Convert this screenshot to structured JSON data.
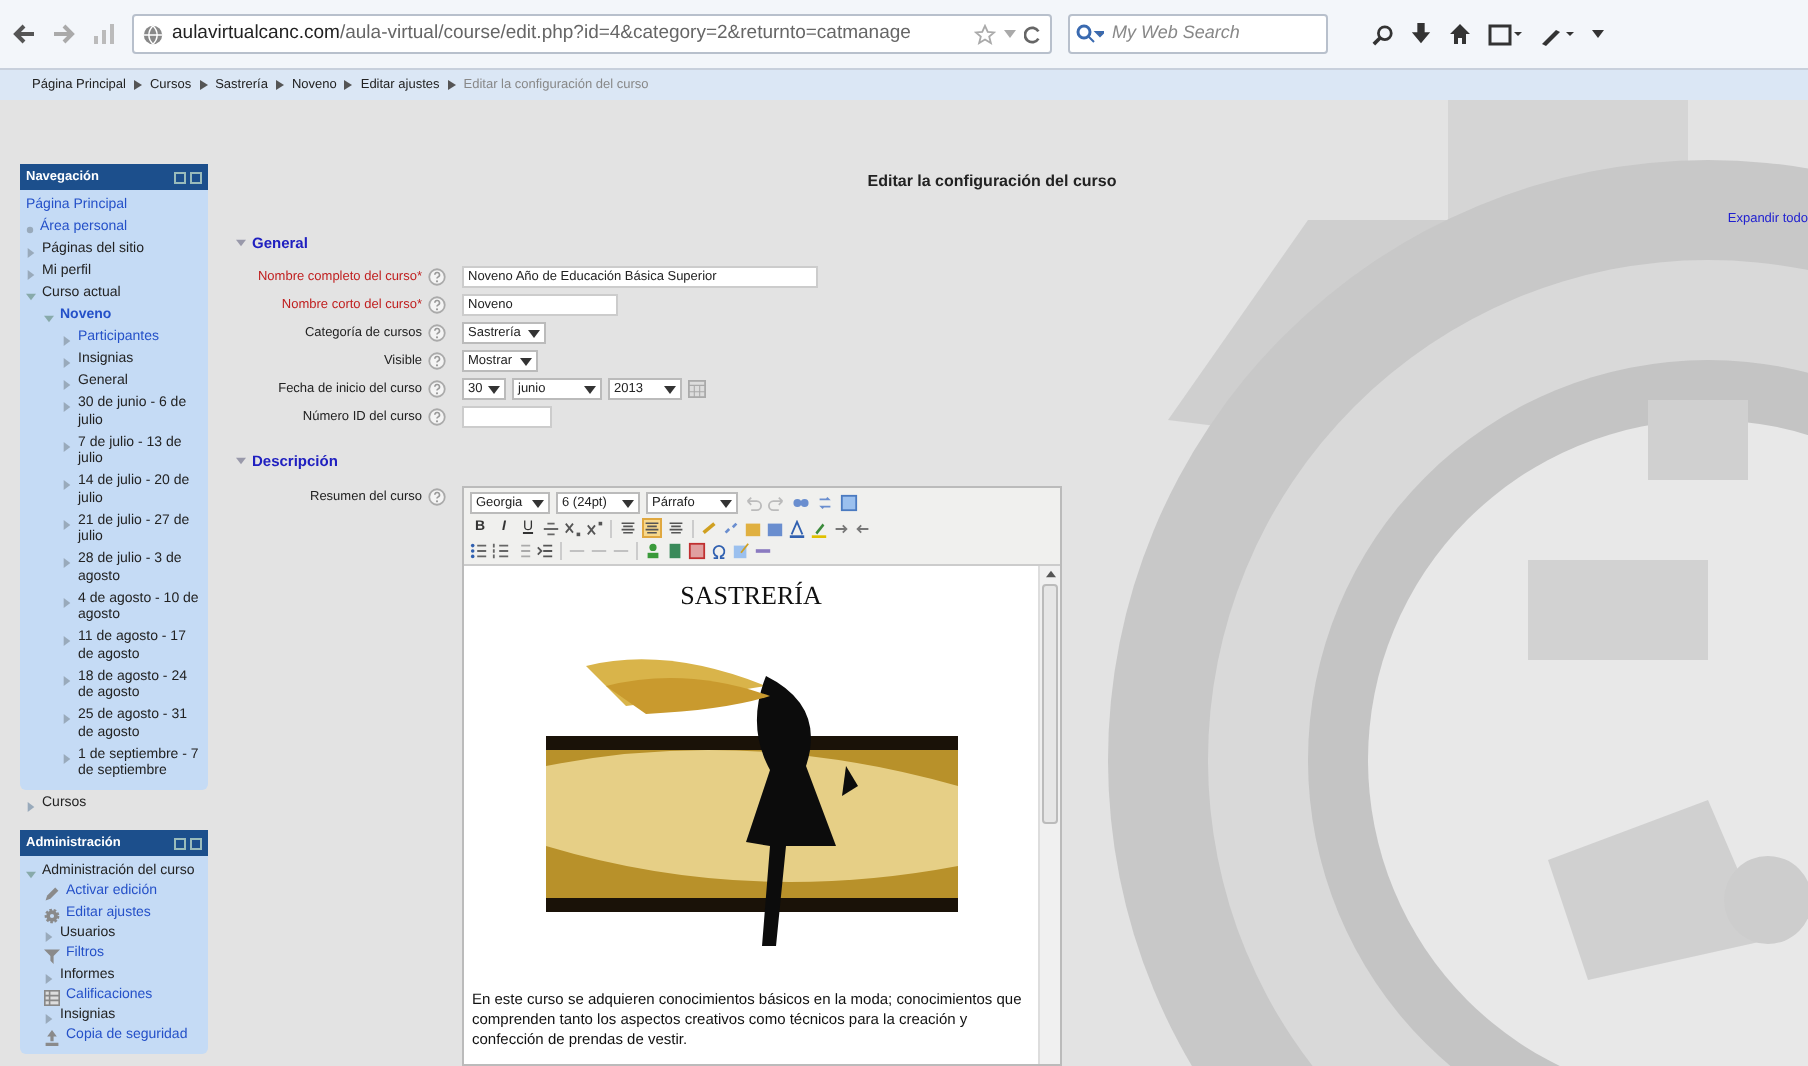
{
  "browser": {
    "url": "**aulavirtualcanc.com**/aula-virtual/course/edit.php?id=4&category=2&returnto=catmanage",
    "search": {
      "placeholder": "My Web Search"
    }
  },
  "breadcrumb": [
    {
      "label": "Página Principal",
      "current": false
    },
    {
      "label": "Cursos",
      "current": false
    },
    {
      "label": "Sastrería",
      "current": false
    },
    {
      "label": "Noveno",
      "current": false
    },
    {
      "label": "Editar ajustes",
      "current": false
    },
    {
      "label": "Editar la configuración del curso",
      "current": true
    }
  ],
  "navigation": {
    "title": "Navegación",
    "items": [
      {
        "label": "Página Principal",
        "kind": "plain",
        "link": true
      },
      {
        "label": "Área personal",
        "kind": "bullet",
        "link": true
      },
      {
        "label": "Páginas del sitio",
        "kind": "branch",
        "expanded": false,
        "link": false
      },
      {
        "label": "Mi perfil",
        "kind": "branch",
        "expanded": false,
        "link": false
      },
      {
        "label": "Curso actual",
        "kind": "branch",
        "expanded": true,
        "link": false,
        "children": [
          {
            "label": "Noveno",
            "kind": "branch",
            "expanded": true,
            "link": true,
            "current": true,
            "children": [
              {
                "label": "Participantes",
                "kind": "branch",
                "expanded": false,
                "link": true
              },
              {
                "label": "Insignias",
                "kind": "branch",
                "expanded": false,
                "link": false
              },
              {
                "label": "General",
                "kind": "branch",
                "expanded": false,
                "link": false
              },
              {
                "label": "30 de junio - 6 de julio",
                "kind": "branch",
                "expanded": false,
                "link": false
              },
              {
                "label": "7 de julio - 13 de julio",
                "kind": "branch",
                "expanded": false,
                "link": false
              },
              {
                "label": "14 de julio - 20 de julio",
                "kind": "branch",
                "expanded": false,
                "link": false
              },
              {
                "label": "21 de julio - 27 de julio",
                "kind": "branch",
                "expanded": false,
                "link": false
              },
              {
                "label": "28 de julio - 3 de agosto",
                "kind": "branch",
                "expanded": false,
                "link": false
              },
              {
                "label": "4 de agosto - 10 de agosto",
                "kind": "branch",
                "expanded": false,
                "link": false
              },
              {
                "label": "11 de agosto - 17 de agosto",
                "kind": "branch",
                "expanded": false,
                "link": false
              },
              {
                "label": "18 de agosto - 24 de agosto",
                "kind": "branch",
                "expanded": false,
                "link": false
              },
              {
                "label": "25 de agosto - 31 de agosto",
                "kind": "branch",
                "expanded": false,
                "link": false
              },
              {
                "label": "1 de septiembre - 7 de septiembre",
                "kind": "branch",
                "expanded": false,
                "link": false
              }
            ]
          }
        ]
      }
    ],
    "outside": [
      {
        "label": "Cursos",
        "kind": "branch",
        "expanded": false,
        "link": false
      }
    ]
  },
  "administration": {
    "title": "Administración",
    "items": [
      {
        "label": "Administración del curso",
        "kind": "branch",
        "expanded": true,
        "link": false,
        "children": [
          {
            "label": "Activar edición",
            "kind": "icon",
            "link": true
          },
          {
            "label": "Editar ajustes",
            "kind": "icon",
            "link": true
          },
          {
            "label": "Usuarios",
            "kind": "branch",
            "expanded": false,
            "link": false
          },
          {
            "label": "Filtros",
            "kind": "icon",
            "link": true
          },
          {
            "label": "Informes",
            "kind": "branch",
            "expanded": false,
            "link": false
          },
          {
            "label": "Calificaciones",
            "kind": "icon",
            "link": true
          },
          {
            "label": "Insignias",
            "kind": "branch",
            "expanded": false,
            "link": false
          },
          {
            "label": "Copia de seguridad",
            "kind": "icon",
            "link": true
          }
        ]
      }
    ]
  },
  "page_title": "Editar la configuración del curso",
  "expand_all": "Expandir todo",
  "sections": [
    {
      "legend": "General",
      "expanded": true,
      "fields": [
        {
          "label": "Nombre completo del curso*",
          "required": true,
          "kind": "text",
          "value": "Noveno Año de Educación Básica Superior"
        },
        {
          "label": "Nombre corto del curso*",
          "required": true,
          "kind": "text",
          "value": "Noveno"
        },
        {
          "label": "Categoría de cursos",
          "required": false,
          "kind": "select",
          "value": "Sastrería"
        },
        {
          "label": "Visible",
          "required": false,
          "kind": "select",
          "value": "Mostrar"
        },
        {
          "label": "Fecha de inicio del curso",
          "required": false,
          "kind": "date",
          "day": "30",
          "month": "junio",
          "year": "2013"
        },
        {
          "label": "Número ID del curso",
          "required": false,
          "kind": "text"
        }
      ]
    },
    {
      "legend": "Descripción",
      "expanded": true,
      "fields": [
        {
          "label": "Resumen del curso",
          "required": false,
          "kind": "editor"
        }
      ]
    }
  ],
  "editor": {
    "font": "Georgia",
    "size": "6 (24pt)",
    "format": "Párrafo",
    "bold": "B",
    "italic": "I",
    "underline": "U",
    "alignments": [
      {
        "selected": false
      },
      {
        "selected": true
      },
      {
        "selected": false
      }
    ],
    "heading": "SASTRERÍA",
    "body": "En este curso se adquieren conocimientos básicos en la moda; conocimientos que comprenden tanto los aspectos creativos como técnicos para la creación y confección de prendas de vestir."
  }
}
